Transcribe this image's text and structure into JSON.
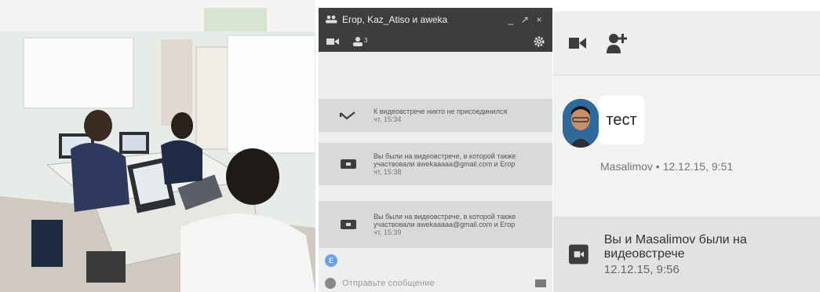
{
  "hangouts": {
    "title": "Егор, Kaz_Atiso и aweka",
    "controls": {
      "minimize": "_",
      "popout": "↗",
      "close": "×"
    },
    "participants_count": "3",
    "events": [
      {
        "text": "К видеовстрече никто не присоединился",
        "time": "чт, 15:34",
        "icon": "missed-call-icon"
      },
      {
        "text": "Вы были на видеовстрече, в которой также участвовали awekaaaaa@gmail.com и Егор",
        "time": "чт, 15:38",
        "icon": "video-camera-icon"
      },
      {
        "text": "Вы были на видеовстрече, в которой также участвовали awekaaaaa@gmail.com и Егор",
        "time": "чт, 15:39",
        "icon": "video-camera-icon"
      }
    ],
    "avatar_letter": "E",
    "input_placeholder": "Отправьте сообщение"
  },
  "zoom": {
    "message": "тест",
    "meta": "Masalimov • 12.12.15, 9:51",
    "event_text": "Вы и Masalimov были на видеовстрече",
    "event_time": "12.12.15, 9:56"
  },
  "colors": {
    "titlebar": "#3d3d3d",
    "event_row": "#d9d9d9",
    "avatar_blue": "#6aa0ea"
  }
}
